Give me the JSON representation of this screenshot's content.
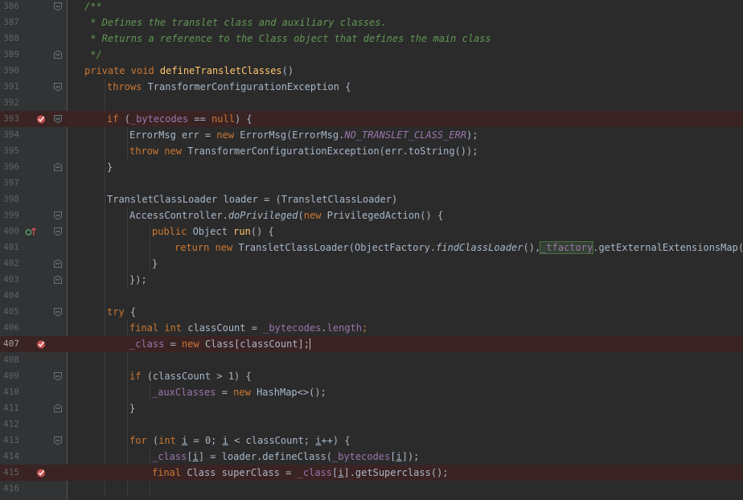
{
  "editor": {
    "current_line": 407,
    "colors": {
      "background": "#2b2b2b",
      "gutter": "#313335",
      "keyword": "#cc7832",
      "method_declaration": "#ffc66d",
      "field": "#9876aa",
      "doc_comment": "#629755",
      "text": "#a9b7c6",
      "line_number": "#606366",
      "breakpoint": "#c75450",
      "breakpoint_line": "#3a2323"
    },
    "lines": [
      {
        "number": "386",
        "fold": "open",
        "indent": 0,
        "tokens": [
          {
            "t": "/**",
            "c": "cmt"
          }
        ]
      },
      {
        "number": "387",
        "indent": 0,
        "tokens": [
          {
            "t": " * Defines the translet class and auxiliary classes.",
            "c": "cmt"
          }
        ]
      },
      {
        "number": "388",
        "indent": 0,
        "tokens": [
          {
            "t": " * Returns a reference to the Class object that defines the main class",
            "c": "cmt"
          }
        ]
      },
      {
        "number": "389",
        "fold": "close",
        "indent": 0,
        "tokens": [
          {
            "t": " */",
            "c": "cmt"
          }
        ]
      },
      {
        "number": "390",
        "indent": 0,
        "tokens": [
          {
            "t": "private void ",
            "c": "kw"
          },
          {
            "t": "defineTransletClasses",
            "c": "fn"
          },
          {
            "t": "()"
          }
        ]
      },
      {
        "number": "391",
        "fold": "open",
        "indent": 1,
        "tokens": [
          {
            "t": "throws ",
            "c": "kw"
          },
          {
            "t": "TransformerConfigurationException {"
          }
        ]
      },
      {
        "number": "392",
        "indent": 0,
        "tokens": []
      },
      {
        "number": "393",
        "fold": "open",
        "breakpoint": true,
        "indent": 1,
        "tokens": [
          {
            "t": "if ",
            "c": "kw"
          },
          {
            "t": "("
          },
          {
            "t": "_bytecodes",
            "c": "fld"
          },
          {
            "t": " == "
          },
          {
            "t": "null",
            "c": "kw"
          },
          {
            "t": ") {"
          }
        ]
      },
      {
        "number": "394",
        "indent": 2,
        "tokens": [
          {
            "t": "ErrorMsg err = "
          },
          {
            "t": "new ",
            "c": "kw"
          },
          {
            "t": "ErrorMsg(ErrorMsg."
          },
          {
            "t": "NO_TRANSLET_CLASS_ERR",
            "c": "static"
          },
          {
            "t": ");"
          }
        ]
      },
      {
        "number": "395",
        "indent": 2,
        "tokens": [
          {
            "t": "throw new ",
            "c": "kw"
          },
          {
            "t": "TransformerConfigurationException(err.toString());"
          }
        ]
      },
      {
        "number": "396",
        "fold": "close",
        "indent": 1,
        "tokens": [
          {
            "t": "}"
          }
        ]
      },
      {
        "number": "397",
        "indent": 0,
        "tokens": []
      },
      {
        "number": "398",
        "indent": 1,
        "tokens": [
          {
            "t": "TransletClassLoader loader = (TransletClassLoader)"
          }
        ]
      },
      {
        "number": "399",
        "fold": "open",
        "indent": 2,
        "tokens": [
          {
            "t": "AccessController."
          },
          {
            "t": "doPrivileged",
            "c": "it"
          },
          {
            "t": "("
          },
          {
            "t": "new ",
            "c": "kw"
          },
          {
            "t": "PrivilegedAction() {"
          }
        ]
      },
      {
        "number": "400",
        "fold": "open",
        "override": true,
        "indent": 3,
        "tokens": [
          {
            "t": "public ",
            "c": "kw"
          },
          {
            "t": "Object "
          },
          {
            "t": "run",
            "c": "fn"
          },
          {
            "t": "() {"
          }
        ]
      },
      {
        "number": "401",
        "indent": 4,
        "tokens": [
          {
            "t": "return new ",
            "c": "kw"
          },
          {
            "t": "TransletClassLoader(ObjectFactory."
          },
          {
            "t": "findClassLoader",
            "c": "it"
          },
          {
            "t": "(),"
          },
          {
            "t": "_tfactory",
            "c": "fld hl"
          },
          {
            "t": ".getExternalExtensionsMap());"
          }
        ]
      },
      {
        "number": "402",
        "fold": "close",
        "indent": 3,
        "tokens": [
          {
            "t": "}"
          }
        ]
      },
      {
        "number": "403",
        "fold": "close",
        "indent": 2,
        "tokens": [
          {
            "t": "});"
          }
        ]
      },
      {
        "number": "404",
        "indent": 0,
        "tokens": []
      },
      {
        "number": "405",
        "fold": "open",
        "indent": 1,
        "tokens": [
          {
            "t": "try ",
            "c": "kw"
          },
          {
            "t": "{"
          }
        ]
      },
      {
        "number": "406",
        "indent": 2,
        "tokens": [
          {
            "t": "final int ",
            "c": "kw"
          },
          {
            "t": "classCount = "
          },
          {
            "t": "_bytecodes",
            "c": "fld"
          },
          {
            "t": "."
          },
          {
            "t": "length",
            "c": "fld"
          },
          {
            "t": ";",
            "c": "kw"
          }
        ]
      },
      {
        "number": "407",
        "breakpoint": true,
        "caret": true,
        "indent": 2,
        "tokens": [
          {
            "t": "_class",
            "c": "fld"
          },
          {
            "t": " = "
          },
          {
            "t": "new ",
            "c": "kw"
          },
          {
            "t": "Class[classCount];"
          }
        ]
      },
      {
        "number": "408",
        "indent": 0,
        "tokens": []
      },
      {
        "number": "409",
        "fold": "open",
        "indent": 2,
        "tokens": [
          {
            "t": "if ",
            "c": "kw"
          },
          {
            "t": "(classCount > 1) {"
          }
        ]
      },
      {
        "number": "410",
        "indent": 3,
        "tokens": [
          {
            "t": "_auxClasses",
            "c": "fld"
          },
          {
            "t": " = "
          },
          {
            "t": "new ",
            "c": "kw"
          },
          {
            "t": "HashMap<>();"
          }
        ]
      },
      {
        "number": "411",
        "fold": "close",
        "indent": 2,
        "tokens": [
          {
            "t": "}"
          }
        ]
      },
      {
        "number": "412",
        "indent": 0,
        "tokens": []
      },
      {
        "number": "413",
        "fold": "open",
        "indent": 2,
        "tokens": [
          {
            "t": "for ",
            "c": "kw"
          },
          {
            "t": "("
          },
          {
            "t": "int ",
            "c": "kw"
          },
          {
            "t": "i",
            "c": "ul"
          },
          {
            "t": " = 0; "
          },
          {
            "t": "i",
            "c": "ul"
          },
          {
            "t": " < classCount; "
          },
          {
            "t": "i",
            "c": "ul"
          },
          {
            "t": "++) {"
          }
        ]
      },
      {
        "number": "414",
        "indent": 3,
        "tokens": [
          {
            "t": "_class",
            "c": "fld"
          },
          {
            "t": "["
          },
          {
            "t": "i",
            "c": "ul"
          },
          {
            "t": "] = loader.defineClass("
          },
          {
            "t": "_bytecodes",
            "c": "fld"
          },
          {
            "t": "["
          },
          {
            "t": "i",
            "c": "ul"
          },
          {
            "t": "]);"
          }
        ]
      },
      {
        "number": "415",
        "breakpoint": true,
        "indent": 3,
        "tokens": [
          {
            "t": "final ",
            "c": "kw"
          },
          {
            "t": "Class superClass = "
          },
          {
            "t": "_class",
            "c": "fld"
          },
          {
            "t": "["
          },
          {
            "t": "i",
            "c": "ul"
          },
          {
            "t": "].getSuperclass();"
          }
        ]
      },
      {
        "number": "416",
        "indent": 0,
        "tokens": []
      }
    ],
    "indent_guides": [
      {
        "level": 1,
        "from": 391,
        "to": 416
      },
      {
        "level": 2,
        "from": 394,
        "to": 395
      },
      {
        "level": 2,
        "from": 399,
        "to": 403
      },
      {
        "level": 3,
        "from": 400,
        "to": 402
      },
      {
        "level": 2,
        "from": 406,
        "to": 416
      },
      {
        "level": 3,
        "from": 410,
        "to": 410
      },
      {
        "level": 3,
        "from": 414,
        "to": 416
      }
    ]
  }
}
